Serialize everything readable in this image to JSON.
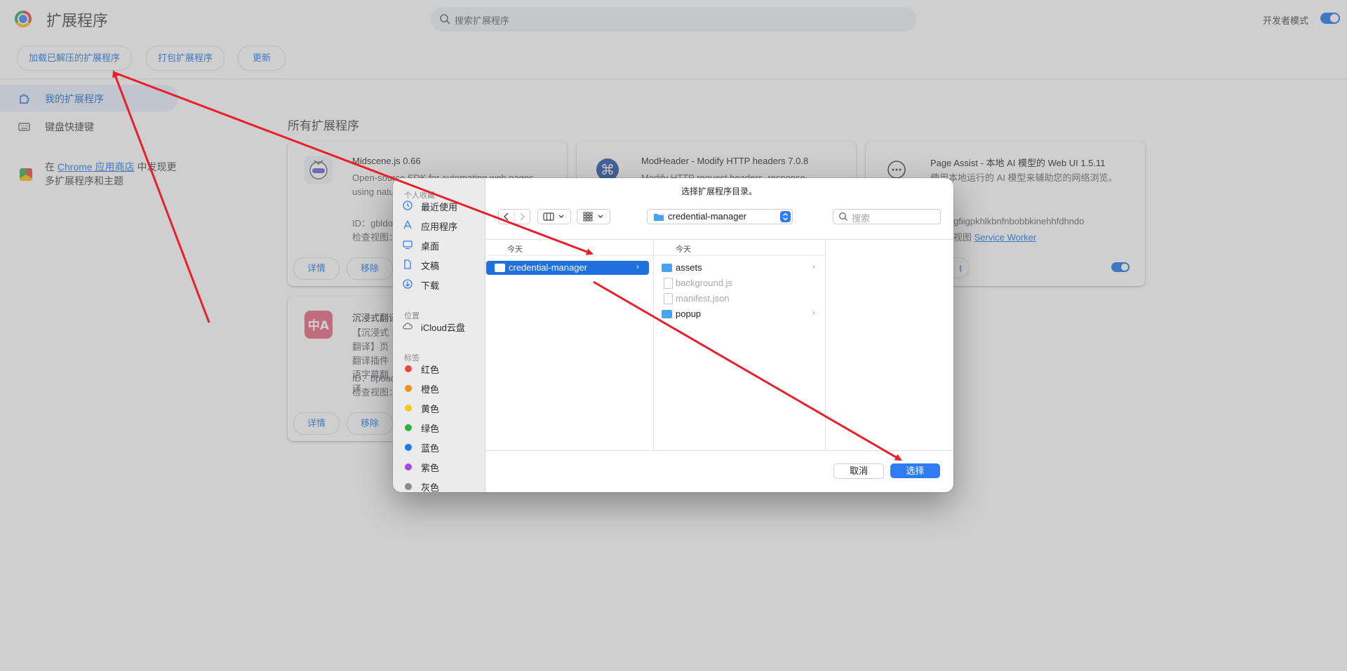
{
  "page": {
    "title": "扩展程序",
    "search_placeholder": "搜索扩展程序",
    "dev_mode_label": "开发者模式",
    "dev_mode_on": true,
    "toolbar": {
      "load_unpacked": "加载已解压的扩展程序",
      "pack": "打包扩展程序",
      "update": "更新"
    },
    "sidebar": {
      "my_extensions": "我的扩展程序",
      "keyboard_shortcuts": "键盘快捷键",
      "store_prefix": "在 ",
      "store_link": "Chrome 应用商店",
      "store_suffix": " 中发现更多扩展程序和主题"
    },
    "section_title": "所有扩展程序",
    "cards": [
      {
        "name": "Midscene.js  0.66",
        "desc": "Open-source SDK for automating web pages using natu",
        "id": "ID：gbldo",
        "inspect": "检查视图：",
        "details": "详情",
        "remove": "移除"
      },
      {
        "name": "ModHeader - Modify HTTP headers  7.0.8",
        "desc": "Modify HTTP request headers, response"
      },
      {
        "name": "Page Assist - 本地 AI 模型的 Web UI  1.5.11",
        "desc": "使用本地运行的 AI 模型来辅助您的网络浏览。",
        "id": "gfiigpkhlkbnfnbobbkinehhfdhndo",
        "inspect_prefix": "视图 ",
        "inspect_link": "Service Worker",
        "details_partial": "t",
        "enabled": true
      },
      {
        "name": "沉浸式翻译",
        "desc": "【沉浸式翻译】页翻译插件语字幕翻译",
        "id": "ID：bpoad",
        "inspect": "检查视图：",
        "details": "详情",
        "remove": "移除"
      }
    ]
  },
  "dialog": {
    "title": "选择扩展程序目录。",
    "sidebar": {
      "favorites_header": "个人收藏",
      "favorites": [
        {
          "label": "最近使用",
          "icon": "clock-icon"
        },
        {
          "label": "应用程序",
          "icon": "apps-icon"
        },
        {
          "label": "桌面",
          "icon": "desktop-icon"
        },
        {
          "label": "文稿",
          "icon": "document-icon"
        },
        {
          "label": "下载",
          "icon": "download-icon"
        }
      ],
      "locations_header": "位置",
      "locations": [
        {
          "label": "iCloud云盘",
          "icon": "cloud-icon"
        }
      ],
      "tags_header": "标签",
      "tags": [
        {
          "label": "红色",
          "color": "#f0463c"
        },
        {
          "label": "橙色",
          "color": "#f58c1e"
        },
        {
          "label": "黄色",
          "color": "#f5c81e"
        },
        {
          "label": "绿色",
          "color": "#2db43c"
        },
        {
          "label": "蓝色",
          "color": "#1e78f0"
        },
        {
          "label": "紫色",
          "color": "#a54bdc"
        },
        {
          "label": "灰色",
          "color": "#8c8c8c"
        }
      ]
    },
    "path_popup": "credential-manager",
    "search_placeholder": "搜索",
    "columns": [
      {
        "header": "今天",
        "items": [
          {
            "name": "credential-manager",
            "type": "folder",
            "selected": true
          }
        ]
      },
      {
        "header": "今天",
        "items": [
          {
            "name": "assets",
            "type": "folder"
          },
          {
            "name": "background.js",
            "type": "file",
            "disabled": true
          },
          {
            "name": "manifest.json",
            "type": "file",
            "disabled": true
          },
          {
            "name": "popup",
            "type": "folder"
          }
        ]
      }
    ],
    "cancel": "取消",
    "choose": "选择"
  },
  "annotation_color": "#e8202a"
}
